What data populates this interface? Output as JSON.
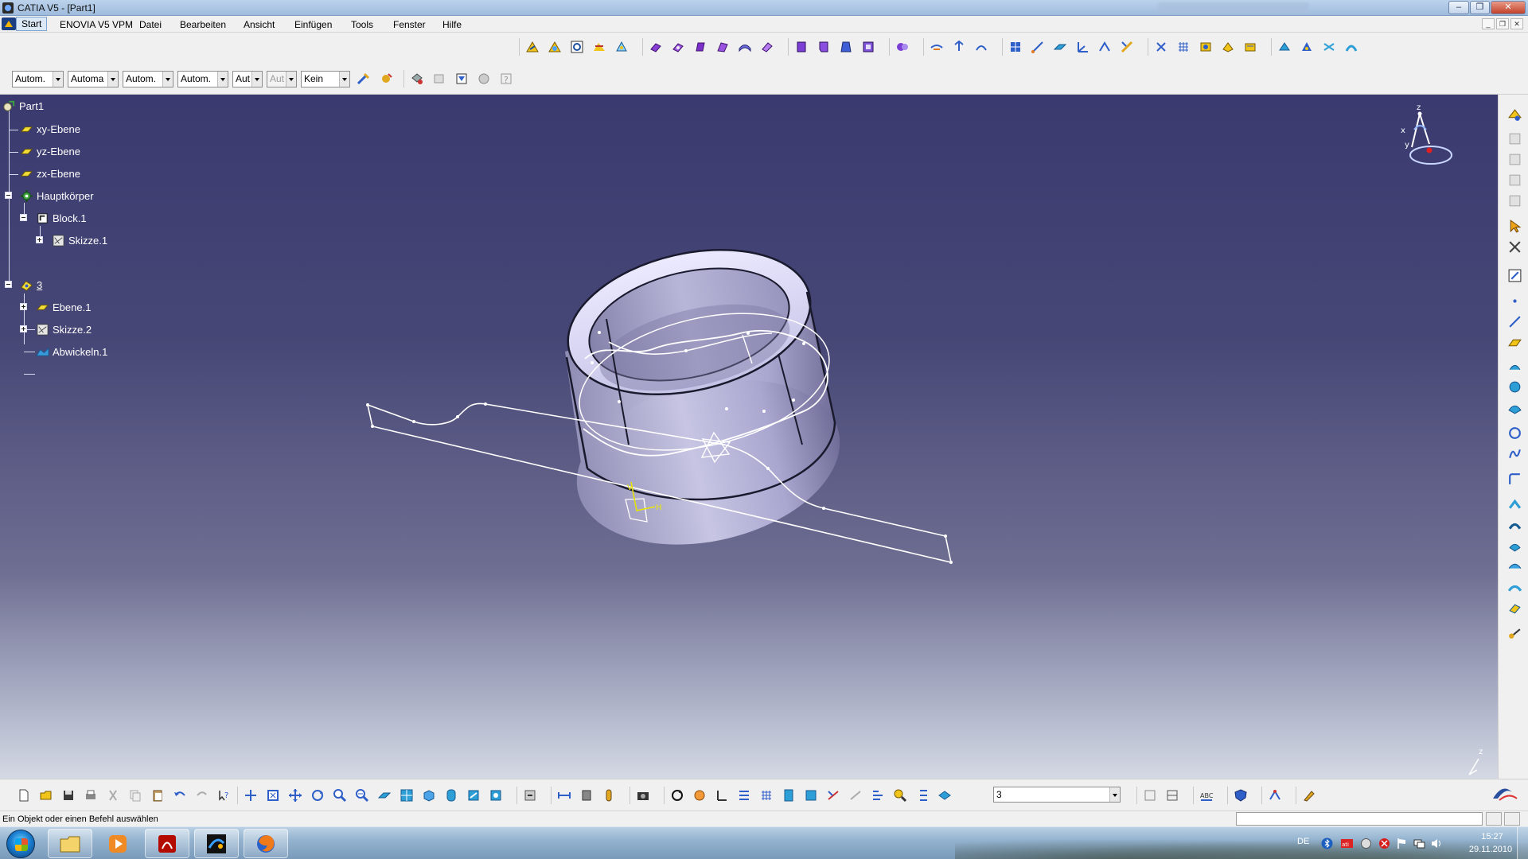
{
  "window": {
    "title": "CATIA V5 - [Part1]",
    "buttons": {
      "minimize": "–",
      "restore": "❐",
      "close": "✕"
    }
  },
  "menubar": {
    "items": [
      "Start",
      "ENOVIA V5 VPM",
      "Datei",
      "Bearbeiten",
      "Ansicht",
      "Einfügen",
      "Tools",
      "Fenster",
      "Hilfe"
    ]
  },
  "properties_toolbar": {
    "dropdowns": [
      "Autom.",
      "Automa",
      "Autom.",
      "Autom.",
      "Aut",
      "Aut",
      "Kein"
    ]
  },
  "tree": {
    "nodes": [
      {
        "label": "Part1",
        "icon": "part-icon"
      },
      {
        "label": "xy-Ebene",
        "icon": "plane-icon"
      },
      {
        "label": "yz-Ebene",
        "icon": "plane-icon"
      },
      {
        "label": "zx-Ebene",
        "icon": "plane-icon"
      },
      {
        "label": "Hauptkörper",
        "icon": "body-gear-icon"
      },
      {
        "label": "Block.1",
        "icon": "pad-icon"
      },
      {
        "label": "Skizze.1",
        "icon": "sketch-icon"
      },
      {
        "label": "3",
        "icon": "geometrical-set-icon"
      },
      {
        "label": "Ebene.1",
        "icon": "plane-icon"
      },
      {
        "label": "Skizze.2",
        "icon": "sketch-icon"
      },
      {
        "label": "Abwickeln.1",
        "icon": "unfold-icon"
      }
    ]
  },
  "compass": {
    "x": "x",
    "y": "y",
    "z": "z"
  },
  "viewport_labels": {
    "H": "H",
    "V": "V",
    "mini_axis_z": "z"
  },
  "bottom_toolbar": {
    "layer_value": "3"
  },
  "statusbar": {
    "text": "Ein Objekt oder einen Befehl auswählen"
  },
  "taskbar": {
    "language": "DE",
    "time": "15:27",
    "date": "29.11.2010"
  },
  "colors": {
    "viewport_top": "#3a3a70",
    "viewport_bottom": "#d5d9e4",
    "part_surface": "#b9b7d9",
    "wireframe": "#ffffff"
  }
}
